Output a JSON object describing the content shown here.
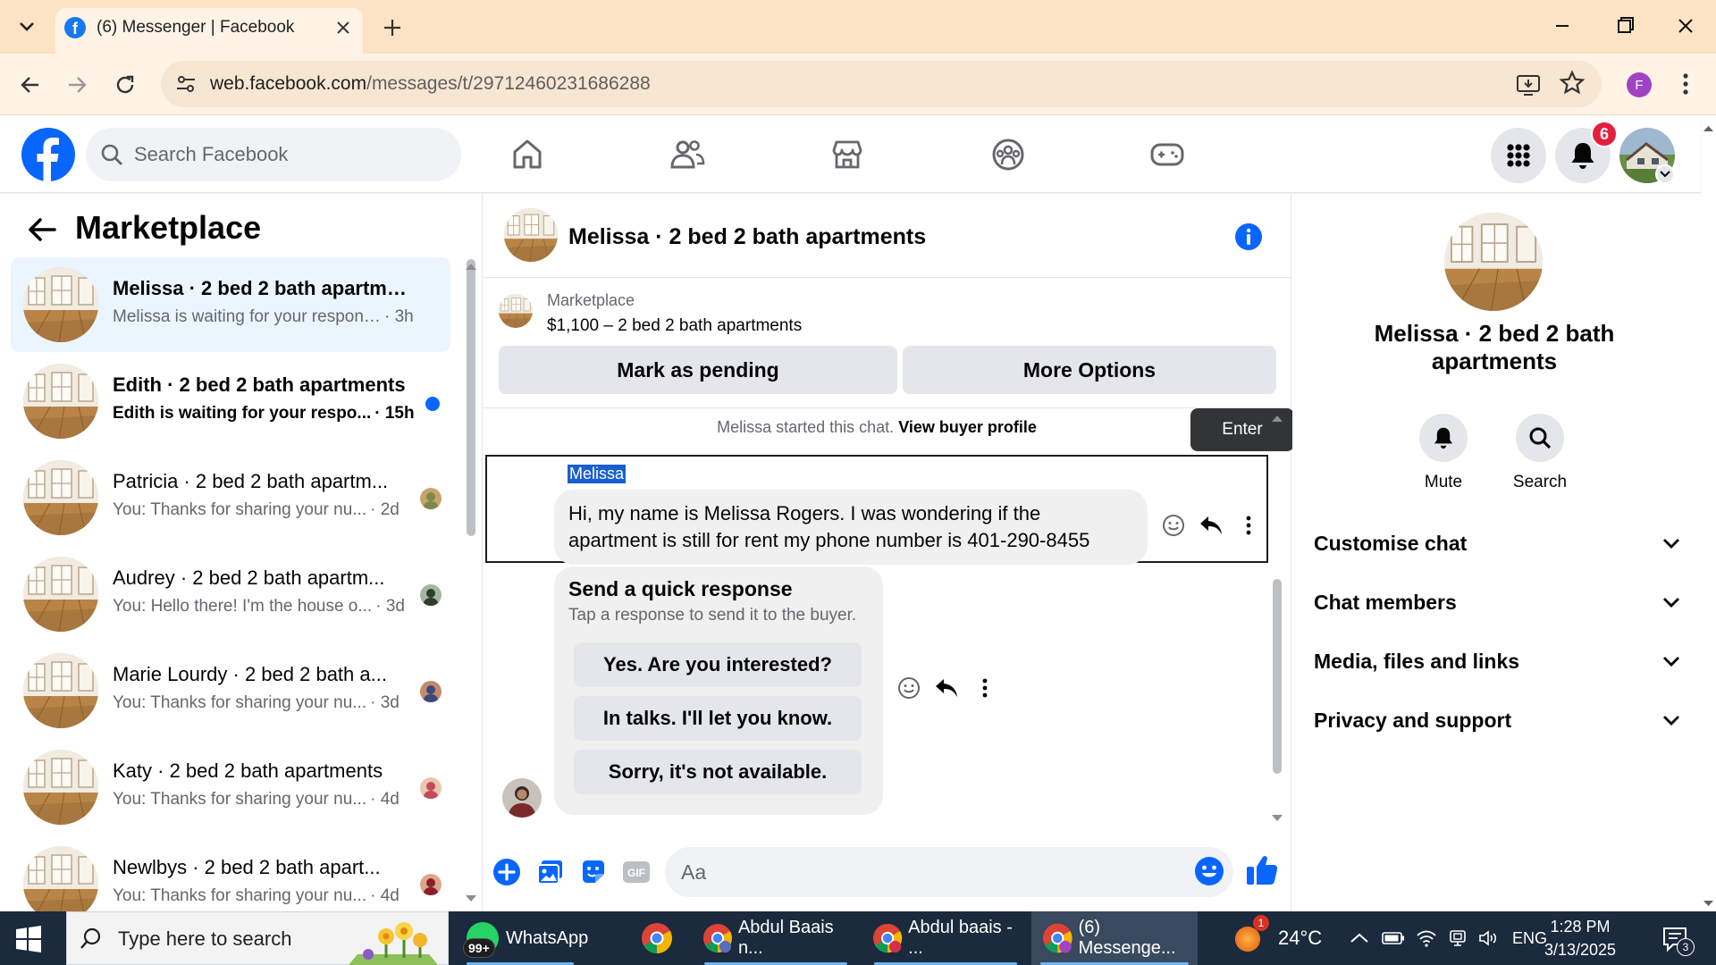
{
  "browser": {
    "tab_title": "(6) Messenger | Facebook",
    "url_host": "web.facebook.com",
    "url_path": "/messages/t/29712460231686288",
    "profile_initial": "F"
  },
  "fb_header": {
    "search_placeholder": "Search Facebook",
    "notification_count": "6"
  },
  "left_panel": {
    "title": "Marketplace",
    "conversations": [
      {
        "name": "Melissa · 2 bed 2 bath apartments",
        "preview": "Melissa is waiting for your response.",
        "time": "· 3h",
        "active": true
      },
      {
        "name": "Edith · 2 bed 2 bath apartments",
        "preview": "Edith is waiting for your respo...",
        "time": "· 15h",
        "unread": true
      },
      {
        "name": "Patricia · 2 bed 2 bath apartm...",
        "preview": "You: Thanks for sharing your nu...",
        "time": "· 2d"
      },
      {
        "name": "Audrey · 2 bed 2 bath apartm...",
        "preview": "You: Hello there! I'm the house o...",
        "time": "· 3d"
      },
      {
        "name": "Marie Lourdy · 2 bed 2 bath a...",
        "preview": "You: Thanks for sharing your nu...",
        "time": "· 3d"
      },
      {
        "name": "Katy · 2 bed 2 bath apartments",
        "preview": "You: Thanks for sharing your nu...",
        "time": "· 4d"
      },
      {
        "name": "Newlbys · 2 bed 2 bath apart...",
        "preview": "You: Thanks for sharing your nu...",
        "time": "· 4d"
      }
    ]
  },
  "chat": {
    "title": "Melissa · 2 bed 2 bath apartments",
    "listing_label": "Marketplace",
    "listing_desc": "$1,100 – 2 bed 2 bath apartments",
    "mark_pending": "Mark as pending",
    "more_options": "More Options",
    "started_text": "Melissa started this chat.",
    "view_buyer": "View buyer profile",
    "tooltip": "Enter",
    "sender": "Melissa",
    "message": "Hi, my name is Melissa Rogers. I was wondering if the apartment is still for rent my phone number is 401-290-8455",
    "quick_title": "Send a quick response",
    "quick_sub": "Tap a response to send it to the buyer.",
    "quick_options": [
      "Yes. Are you interested?",
      "In talks. I'll let you know.",
      "Sorry, it's not available."
    ],
    "composer_placeholder": "Aa"
  },
  "right_panel": {
    "name": "Melissa · 2 bed 2 bath apartments",
    "mute": "Mute",
    "search": "Search",
    "sections": [
      "Customise chat",
      "Chat members",
      "Media, files and links",
      "Privacy and support"
    ]
  },
  "taskbar": {
    "search_placeholder": "Type here to search",
    "whatsapp": "WhatsApp",
    "whatsapp_badge": "99+",
    "chrome1": "Abdul Baais n...",
    "chrome2": "Abdul baais - ...",
    "chrome3": "(6) Messenge...",
    "weather_badge": "1",
    "temperature": "24°C",
    "language": "ENG",
    "time": "1:28 PM",
    "date": "3/13/2025",
    "notif_count": "3"
  },
  "colors": {
    "fb_blue": "#0866ff",
    "tab_strip": "#fce3c3",
    "active_row": "#ebf5ff",
    "taskbar": "#1b2a3d"
  }
}
